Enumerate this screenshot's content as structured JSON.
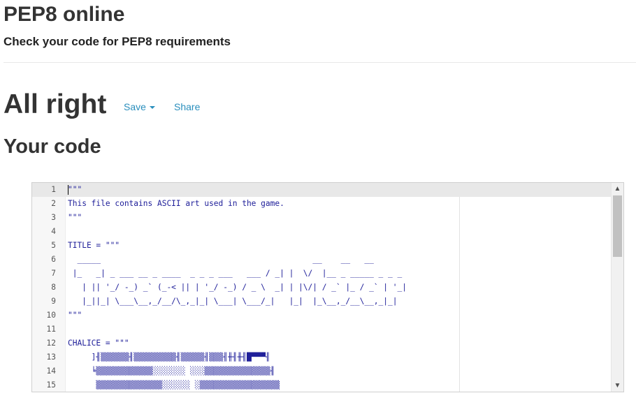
{
  "header": {
    "title": "PEP8 online",
    "subtitle": "Check your code for PEP8 requirements"
  },
  "result": {
    "title": "All right",
    "save_label": "Save",
    "share_label": "Share"
  },
  "code_section": {
    "heading": "Your code"
  },
  "editor": {
    "lines": [
      {
        "number": "1",
        "text": "\"\"\""
      },
      {
        "number": "2",
        "text": "This file contains ASCII art used in the game."
      },
      {
        "number": "3",
        "text": "\"\"\""
      },
      {
        "number": "4",
        "text": ""
      },
      {
        "number": "5",
        "text": "TITLE = \"\"\""
      },
      {
        "number": "6",
        "text": "  _____                                             __    __   __"
      },
      {
        "number": "7",
        "text": " |_   _| _ ___ __ _ ____  _ _ _ ___   ___ / _| |  \\/  |__ _ _____ _ _ _"
      },
      {
        "number": "8",
        "text": "   | || '_/ -_) _` (_-< || | '_/ -_) / _ \\  _| | |\\/| / _` |_ / _` | '_|"
      },
      {
        "number": "9",
        "text": "   |_||_| \\___\\__,_/__/\\_,_|_| \\___| \\___/_|   |_|  |_\\__,_/__\\__,_|_|"
      },
      {
        "number": "10",
        "text": "\"\"\""
      },
      {
        "number": "11",
        "text": ""
      },
      {
        "number": "12",
        "text": "CHALICE = \"\"\""
      },
      {
        "number": "13",
        "text": "     ]╢▒▒▒▒▒▒╢▒▒▒▒▒▒▒▒▒╢▒▒▒▒▒╢▒▒▒╢╫╢╫╢█▀▀▀╢"
      },
      {
        "number": "14",
        "text": "     ╘▒▒▒▒▒▒▒▒▒▒▒▒░░░░░░░ ░░░▒▒▒▒▒▒▒▒▒▒▒▒▒▒╢"
      },
      {
        "number": "15",
        "text": "      ▒▒▒▒▒▒▒▒▒▒▒▒▒▒░░░░░░ ░▒▒▒▒▒▒▒▒▒▒▒▒▒▒▒▒▒"
      }
    ]
  }
}
